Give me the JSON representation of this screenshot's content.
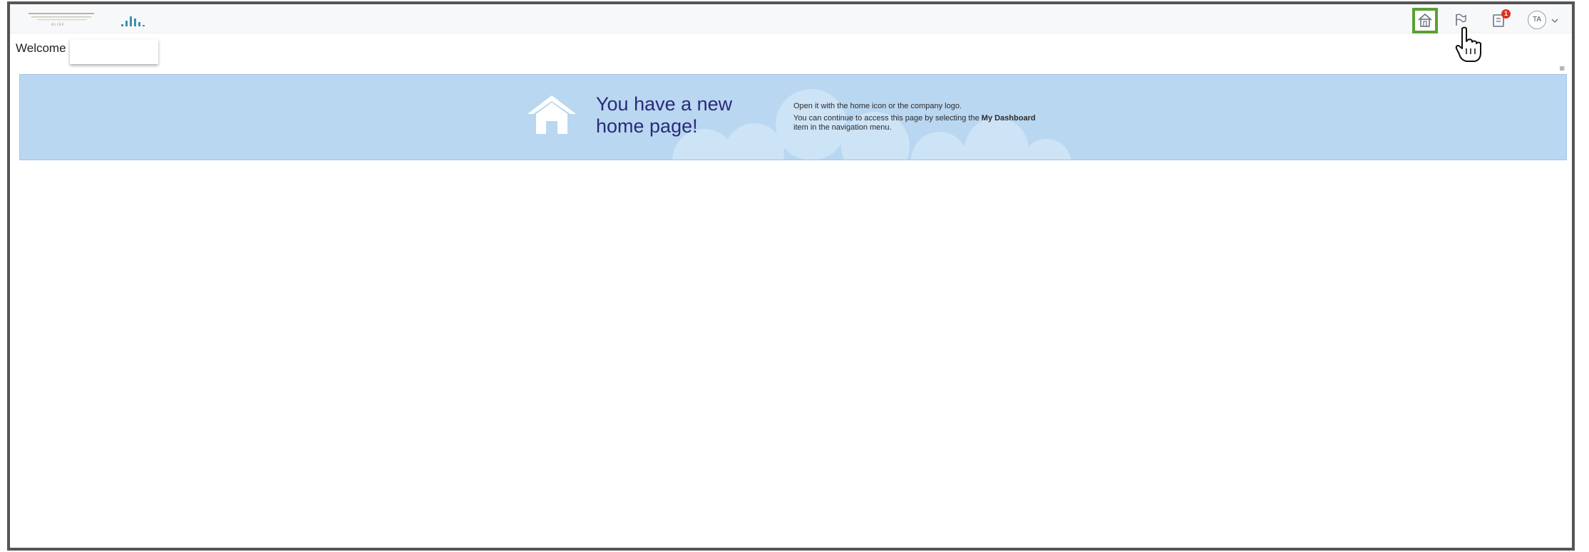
{
  "header": {
    "logo_text": "ALIEF",
    "nav": [
      {
        "name": "home",
        "icon": "home-icon"
      },
      {
        "name": "flag",
        "icon": "flag-icon"
      },
      {
        "name": "notifications",
        "icon": "notification-icon",
        "badge": "1"
      },
      {
        "name": "user-menu",
        "icon": "chevron-down-icon",
        "initials": "TA"
      }
    ]
  },
  "welcome": {
    "label": "Welcome",
    "name": ""
  },
  "banner": {
    "headline": "You have a new home page!",
    "line1": "Open it with the home icon or the company logo.",
    "line2_prefix": "You can continue to access this page by selecting the ",
    "line2_bold": "My Dashboard",
    "line2_suffix": " item in the navigation menu."
  },
  "colors": {
    "banner_bg": "#b9d7f0",
    "headline": "#2a2a7a",
    "highlight": "#5aa033",
    "badge": "#e0301e"
  }
}
